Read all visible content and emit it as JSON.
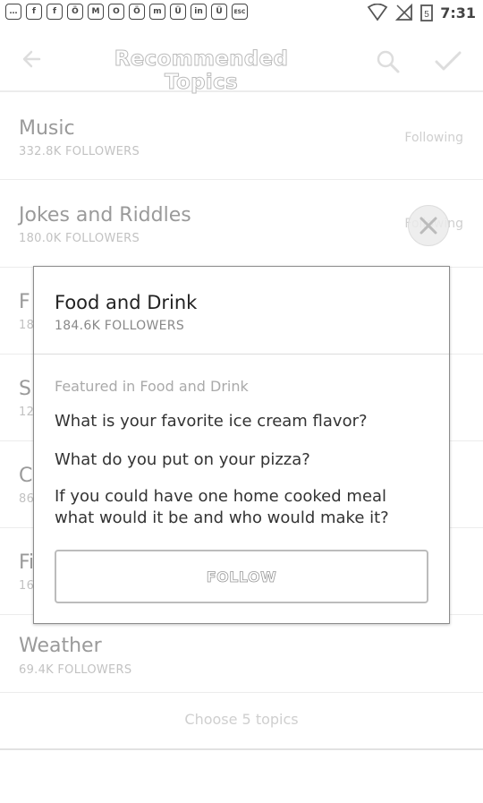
{
  "statusbar": {
    "icons": [
      "…",
      "f",
      "f",
      "Ö",
      "M",
      "O",
      "Ö",
      "m",
      "Ü",
      "in",
      "Ü",
      "ESC"
    ],
    "time": "7:31"
  },
  "header": {
    "title": "Recommended Topics"
  },
  "topics": [
    {
      "name": "Music",
      "followers": "332.8K FOLLOWERS",
      "status": "Following"
    },
    {
      "name": "Jokes and Riddles",
      "followers": "180.0K FOLLOWERS",
      "status": "Following"
    },
    {
      "name": "F",
      "followers": "18",
      "status": ""
    },
    {
      "name": "S",
      "followers": "12",
      "status": ""
    },
    {
      "name": "C",
      "followers": "86",
      "status": ""
    },
    {
      "name": "Fi",
      "followers": "16",
      "status": ""
    },
    {
      "name": "Weather",
      "followers": "69.4K FOLLOWERS",
      "status": ""
    }
  ],
  "dialog": {
    "title": "Food and Drink",
    "followers": "184.6K FOLLOWERS",
    "featured_label": "Featured in Food and Drink",
    "questions": [
      "What is your favorite ice cream flavor?",
      "What do you put on your pizza?",
      "If you could have one home cooked meal what would it be and who would make it?"
    ],
    "follow_label": "FOLLOW"
  },
  "footer": {
    "hint": "Choose 5 topics"
  }
}
